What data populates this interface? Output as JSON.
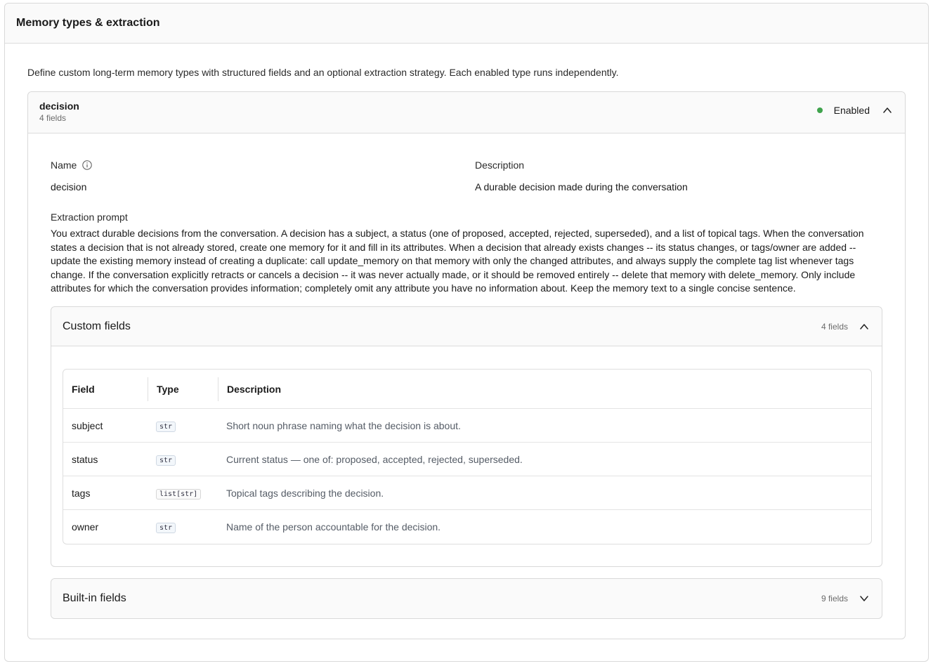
{
  "panel": {
    "title": "Memory types & extraction"
  },
  "intro": "Define custom long-term memory types with structured fields and an optional extraction strategy. Each enabled type runs independently.",
  "memory_type": {
    "name": "decision",
    "field_count": "4 fields",
    "status_label": "Enabled",
    "status_color": "#3fa34d",
    "name_label": "Name",
    "name_value": "decision",
    "description_label": "Description",
    "description_value": "A durable decision made during the conversation",
    "prompt_label": "Extraction prompt",
    "prompt_text": "You extract durable decisions from the conversation. A decision has a subject, a status (one of proposed, accepted, rejected, superseded), and a list of topical tags. When the conversation states a decision that is not already stored, create one memory for it and fill in its attributes. When a decision that already exists changes -- its status changes, or tags/owner are added -- update the existing memory instead of creating a duplicate: call update_memory on that memory with only the changed attributes, and always supply the complete tag list whenever tags change. If the conversation explicitly retracts or cancels a decision -- it was never actually made, or it should be removed entirely -- delete that memory with delete_memory. Only include attributes for which the conversation provides information; completely omit any attribute you have no information about. Keep the memory text to a single concise sentence."
  },
  "custom_fields": {
    "title": "Custom fields",
    "count": "4 fields",
    "columns": [
      "Field",
      "Type",
      "Description"
    ],
    "rows": [
      {
        "field": "subject",
        "type": "str",
        "description": "Short noun phrase naming what the decision is about."
      },
      {
        "field": "status",
        "type": "str",
        "description": "Current status — one of: proposed, accepted, rejected, superseded."
      },
      {
        "field": "tags",
        "type": "list[str]",
        "description": "Topical tags describing the decision."
      },
      {
        "field": "owner",
        "type": "str",
        "description": "Name of the person accountable for the decision."
      }
    ]
  },
  "builtin_fields": {
    "title": "Built-in fields",
    "count": "9 fields"
  }
}
